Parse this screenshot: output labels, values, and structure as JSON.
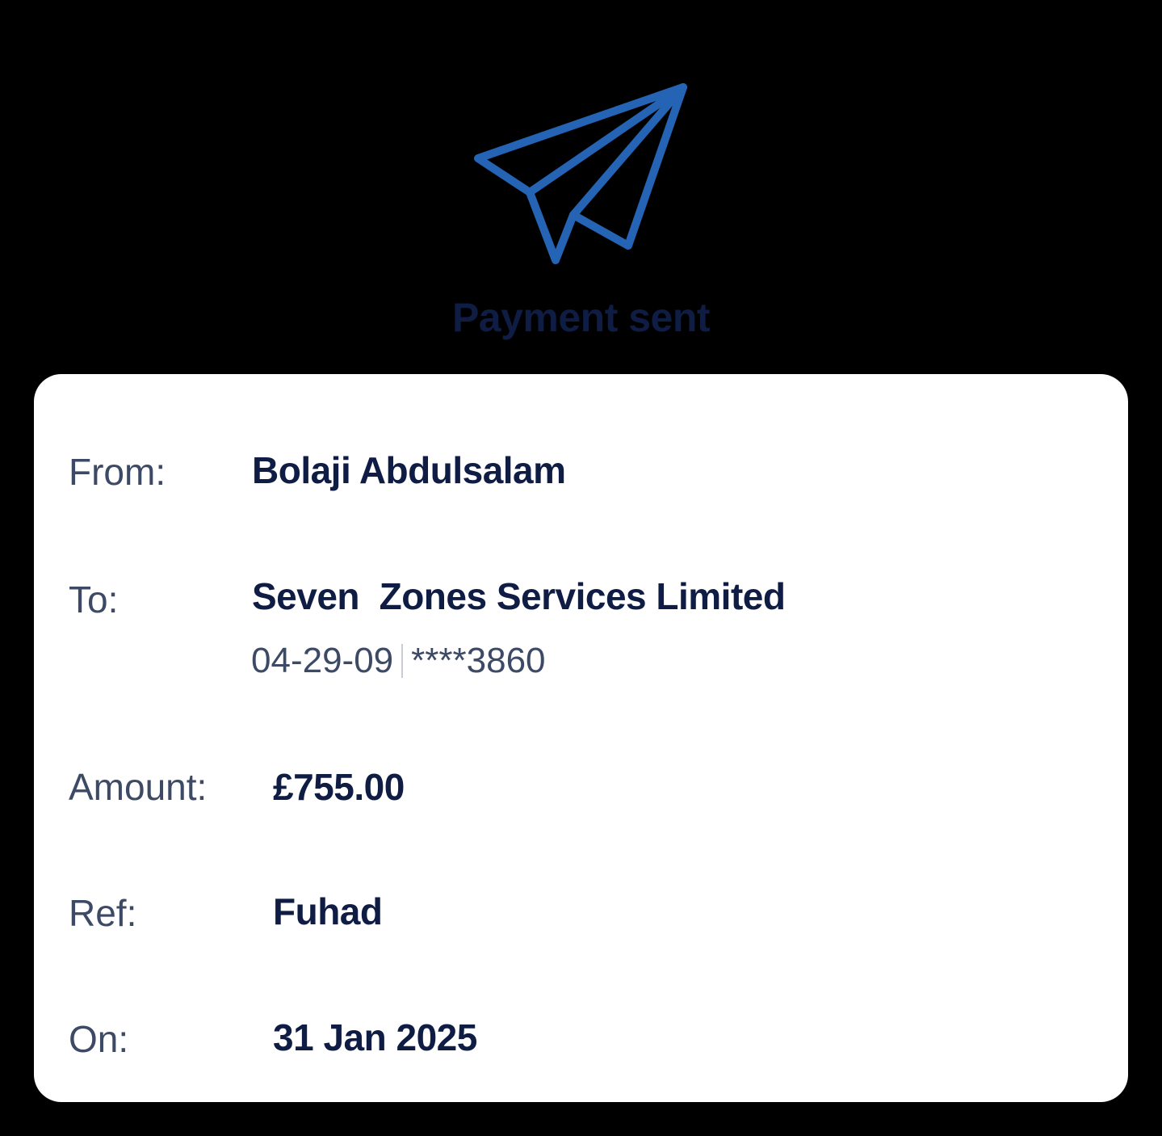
{
  "header": {
    "title": "Payment sent",
    "icon": "paper-plane-icon",
    "icon_color": "#2563b5"
  },
  "details": {
    "from": {
      "label": "From:",
      "value": "Bolaji Abdulsalam"
    },
    "to": {
      "label": "To:",
      "value": "Seven  Zones Services Limited",
      "sort_code": "04-29-09",
      "account": "****3860"
    },
    "amount": {
      "label": "Amount:",
      "value": "£755.00"
    },
    "ref": {
      "label": "Ref:",
      "value": "Fuhad"
    },
    "on": {
      "label": "On:",
      "value": "31 Jan 2025"
    }
  },
  "colors": {
    "background": "#000000",
    "card": "#ffffff",
    "text_primary": "#0f1d44",
    "text_secondary": "#3d4a66"
  }
}
